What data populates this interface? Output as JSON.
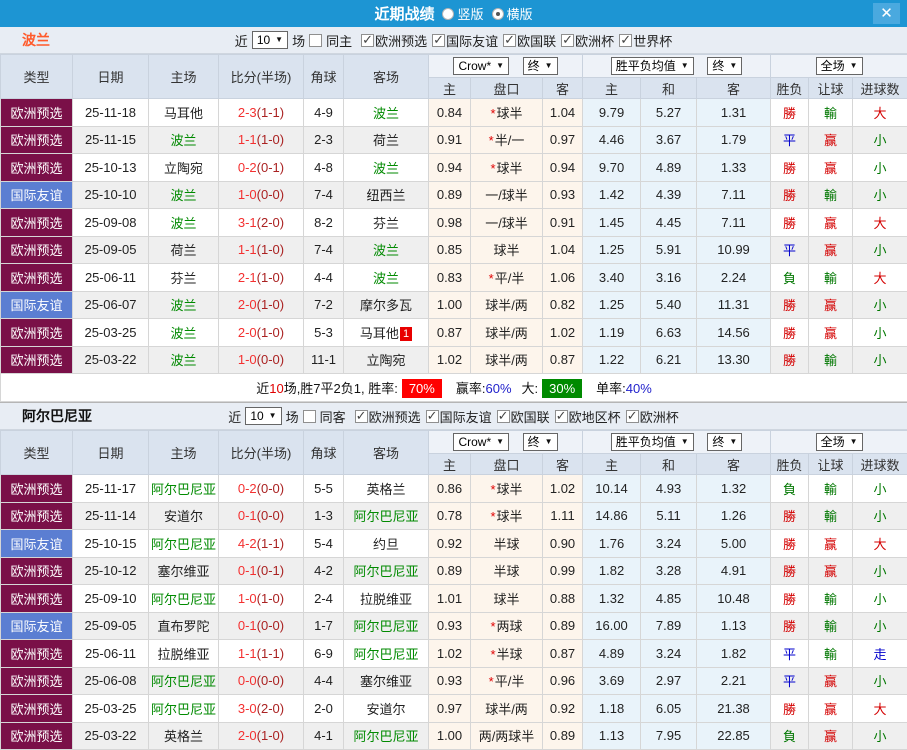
{
  "titlebar": {
    "title": "近期战绩",
    "radios": [
      {
        "label": "竖版",
        "checked": false
      },
      {
        "label": "横版",
        "checked": true
      }
    ],
    "close_icon": "✕"
  },
  "labels": {
    "near": "近",
    "games": "场"
  },
  "controls": {
    "count": "10",
    "odds_source": "Crow*",
    "final": "终",
    "avg": "胜平负均值",
    "fullmatch": "全场"
  },
  "columns": {
    "type": "类型",
    "date": "日期",
    "home": "主场",
    "score": "比分(半场)",
    "corner": "角球",
    "away": "客场",
    "o_home": "主",
    "o_hcp": "盘口",
    "o_away": "客",
    "a_home": "主",
    "a_draw": "和",
    "a_away": "客",
    "r_wdl": "胜负",
    "r_let": "让球",
    "r_goals": "进球数"
  },
  "sections": [
    {
      "team": "波兰",
      "filter": {
        "count": "10",
        "same": {
          "label": "同主",
          "checked": false
        },
        "leagues": [
          {
            "label": "欧洲预选",
            "checked": true
          },
          {
            "label": "国际友谊",
            "checked": true
          },
          {
            "label": "欧国联",
            "checked": true
          },
          {
            "label": "欧洲杯",
            "checked": true
          },
          {
            "label": "世界杯",
            "checked": true
          }
        ]
      },
      "rows": [
        {
          "type": "欧洲预选",
          "friendly": false,
          "date": "25-11-18",
          "home": "马耳他",
          "home_hl": false,
          "score": "2-3",
          "half": "(1-1)",
          "corner": "4-9",
          "away": "波兰",
          "away_hl": true,
          "away_badge": "",
          "odds": [
            "0.84",
            "*球半",
            "1.04"
          ],
          "avg": [
            "9.79",
            "5.27",
            "1.31"
          ],
          "res": [
            "勝",
            "輸",
            "大"
          ]
        },
        {
          "type": "欧洲预选",
          "friendly": false,
          "date": "25-11-15",
          "home": "波兰",
          "home_hl": true,
          "score": "1-1",
          "half": "(1-0)",
          "corner": "2-3",
          "away": "荷兰",
          "away_hl": false,
          "away_badge": "",
          "odds": [
            "0.91",
            "*半/一",
            "0.97"
          ],
          "avg": [
            "4.46",
            "3.67",
            "1.79"
          ],
          "res": [
            "平",
            "赢",
            "小"
          ]
        },
        {
          "type": "欧洲预选",
          "friendly": false,
          "date": "25-10-13",
          "home": "立陶宛",
          "home_hl": false,
          "score": "0-2",
          "half": "(0-1)",
          "corner": "4-8",
          "away": "波兰",
          "away_hl": true,
          "away_badge": "",
          "odds": [
            "0.94",
            "*球半",
            "0.94"
          ],
          "avg": [
            "9.70",
            "4.89",
            "1.33"
          ],
          "res": [
            "勝",
            "赢",
            "小"
          ]
        },
        {
          "type": "国际友谊",
          "friendly": true,
          "date": "25-10-10",
          "home": "波兰",
          "home_hl": true,
          "score": "1-0",
          "half": "(0-0)",
          "corner": "7-4",
          "away": "纽西兰",
          "away_hl": false,
          "away_badge": "",
          "odds": [
            "0.89",
            "一/球半",
            "0.93"
          ],
          "avg": [
            "1.42",
            "4.39",
            "7.11"
          ],
          "res": [
            "勝",
            "輸",
            "小"
          ]
        },
        {
          "type": "欧洲预选",
          "friendly": false,
          "date": "25-09-08",
          "home": "波兰",
          "home_hl": true,
          "score": "3-1",
          "half": "(2-0)",
          "corner": "8-2",
          "away": "芬兰",
          "away_hl": false,
          "away_badge": "",
          "odds": [
            "0.98",
            "一/球半",
            "0.91"
          ],
          "avg": [
            "1.45",
            "4.45",
            "7.11"
          ],
          "res": [
            "勝",
            "赢",
            "大"
          ]
        },
        {
          "type": "欧洲预选",
          "friendly": false,
          "date": "25-09-05",
          "home": "荷兰",
          "home_hl": false,
          "score": "1-1",
          "half": "(1-0)",
          "corner": "7-4",
          "away": "波兰",
          "away_hl": true,
          "away_badge": "",
          "odds": [
            "0.85",
            "球半",
            "1.04"
          ],
          "avg": [
            "1.25",
            "5.91",
            "10.99"
          ],
          "res": [
            "平",
            "赢",
            "小"
          ]
        },
        {
          "type": "欧洲预选",
          "friendly": false,
          "date": "25-06-11",
          "home": "芬兰",
          "home_hl": false,
          "score": "2-1",
          "half": "(1-0)",
          "corner": "4-4",
          "away": "波兰",
          "away_hl": true,
          "away_badge": "",
          "odds": [
            "0.83",
            "*平/半",
            "1.06"
          ],
          "avg": [
            "3.40",
            "3.16",
            "2.24"
          ],
          "res": [
            "負",
            "輸",
            "大"
          ]
        },
        {
          "type": "国际友谊",
          "friendly": true,
          "date": "25-06-07",
          "home": "波兰",
          "home_hl": true,
          "score": "2-0",
          "half": "(1-0)",
          "corner": "7-2",
          "away": "摩尔多瓦",
          "away_hl": false,
          "away_badge": "",
          "odds": [
            "1.00",
            "球半/两",
            "0.82"
          ],
          "avg": [
            "1.25",
            "5.40",
            "11.31"
          ],
          "res": [
            "勝",
            "赢",
            "小"
          ]
        },
        {
          "type": "欧洲预选",
          "friendly": false,
          "date": "25-03-25",
          "home": "波兰",
          "home_hl": true,
          "score": "2-0",
          "half": "(1-0)",
          "corner": "5-3",
          "away": "马耳他",
          "away_hl": false,
          "away_badge": "1",
          "odds": [
            "0.87",
            "球半/两",
            "1.02"
          ],
          "avg": [
            "1.19",
            "6.63",
            "14.56"
          ],
          "res": [
            "勝",
            "赢",
            "小"
          ]
        },
        {
          "type": "欧洲预选",
          "friendly": false,
          "date": "25-03-22",
          "home": "波兰",
          "home_hl": true,
          "score": "1-0",
          "half": "(0-0)",
          "corner": "11-1",
          "away": "立陶宛",
          "away_hl": false,
          "away_badge": "",
          "odds": [
            "1.02",
            "球半/两",
            "0.87"
          ],
          "avg": [
            "1.22",
            "6.21",
            "13.30"
          ],
          "res": [
            "勝",
            "輸",
            "小"
          ]
        }
      ],
      "summary": {
        "near_label": "近",
        "near_count": "10",
        "record": "场,胜7平2负1, 胜率:",
        "win_badge": "70%",
        "profit_label": "赢率:",
        "profit_rate": "60%",
        "big_label": "大:",
        "big_badge": "30%",
        "single_label": "单率:",
        "single_rate": "40%"
      }
    },
    {
      "team": "阿尔巴尼亚",
      "filter": {
        "count": "10",
        "same": {
          "label": "同客",
          "checked": false
        },
        "leagues": [
          {
            "label": "欧洲预选",
            "checked": true
          },
          {
            "label": "国际友谊",
            "checked": true
          },
          {
            "label": "欧国联",
            "checked": true
          },
          {
            "label": "欧地区杯",
            "checked": true
          },
          {
            "label": "欧洲杯",
            "checked": true
          }
        ]
      },
      "rows": [
        {
          "type": "欧洲预选",
          "friendly": false,
          "date": "25-11-17",
          "home": "阿尔巴尼亚",
          "home_hl": true,
          "score": "0-2",
          "half": "(0-0)",
          "corner": "5-5",
          "away": "英格兰",
          "away_hl": false,
          "away_badge": "",
          "odds": [
            "0.86",
            "*球半",
            "1.02"
          ],
          "avg": [
            "10.14",
            "4.93",
            "1.32"
          ],
          "res": [
            "負",
            "輸",
            "小"
          ]
        },
        {
          "type": "欧洲预选",
          "friendly": false,
          "date": "25-11-14",
          "home": "安道尔",
          "home_hl": false,
          "score": "0-1",
          "half": "(0-0)",
          "corner": "1-3",
          "away": "阿尔巴尼亚",
          "away_hl": true,
          "away_badge": "",
          "odds": [
            "0.78",
            "*球半",
            "1.11"
          ],
          "avg": [
            "14.86",
            "5.11",
            "1.26"
          ],
          "res": [
            "勝",
            "輸",
            "小"
          ]
        },
        {
          "type": "国际友谊",
          "friendly": true,
          "date": "25-10-15",
          "home": "阿尔巴尼亚",
          "home_hl": true,
          "score": "4-2",
          "half": "(1-1)",
          "corner": "5-4",
          "away": "约旦",
          "away_hl": false,
          "away_badge": "",
          "odds": [
            "0.92",
            "半球",
            "0.90"
          ],
          "avg": [
            "1.76",
            "3.24",
            "5.00"
          ],
          "res": [
            "勝",
            "赢",
            "大"
          ]
        },
        {
          "type": "欧洲预选",
          "friendly": false,
          "date": "25-10-12",
          "home": "塞尔维亚",
          "home_hl": false,
          "score": "0-1",
          "half": "(0-1)",
          "corner": "4-2",
          "away": "阿尔巴尼亚",
          "away_hl": true,
          "away_badge": "",
          "odds": [
            "0.89",
            "半球",
            "0.99"
          ],
          "avg": [
            "1.82",
            "3.28",
            "4.91"
          ],
          "res": [
            "勝",
            "赢",
            "小"
          ]
        },
        {
          "type": "欧洲预选",
          "friendly": false,
          "date": "25-09-10",
          "home": "阿尔巴尼亚",
          "home_hl": true,
          "score": "1-0",
          "half": "(1-0)",
          "corner": "2-4",
          "away": "拉脱维亚",
          "away_hl": false,
          "away_badge": "",
          "odds": [
            "1.01",
            "球半",
            "0.88"
          ],
          "avg": [
            "1.32",
            "4.85",
            "10.48"
          ],
          "res": [
            "勝",
            "輸",
            "小"
          ]
        },
        {
          "type": "国际友谊",
          "friendly": true,
          "date": "25-09-05",
          "home": "直布罗陀",
          "home_hl": false,
          "score": "0-1",
          "half": "(0-0)",
          "corner": "1-7",
          "away": "阿尔巴尼亚",
          "away_hl": true,
          "away_badge": "",
          "odds": [
            "0.93",
            "*两球",
            "0.89"
          ],
          "avg": [
            "16.00",
            "7.89",
            "1.13"
          ],
          "res": [
            "勝",
            "輸",
            "小"
          ]
        },
        {
          "type": "欧洲预选",
          "friendly": false,
          "date": "25-06-11",
          "home": "拉脱维亚",
          "home_hl": false,
          "score": "1-1",
          "half": "(1-1)",
          "corner": "6-9",
          "away": "阿尔巴尼亚",
          "away_hl": true,
          "away_badge": "",
          "odds": [
            "1.02",
            "*半球",
            "0.87"
          ],
          "avg": [
            "4.89",
            "3.24",
            "1.82"
          ],
          "res": [
            "平",
            "輸",
            "走"
          ]
        },
        {
          "type": "欧洲预选",
          "friendly": false,
          "date": "25-06-08",
          "home": "阿尔巴尼亚",
          "home_hl": true,
          "score": "0-0",
          "half": "(0-0)",
          "corner": "4-4",
          "away": "塞尔维亚",
          "away_hl": false,
          "away_badge": "",
          "odds": [
            "0.93",
            "*平/半",
            "0.96"
          ],
          "avg": [
            "3.69",
            "2.97",
            "2.21"
          ],
          "res": [
            "平",
            "赢",
            "小"
          ]
        },
        {
          "type": "欧洲预选",
          "friendly": false,
          "date": "25-03-25",
          "home": "阿尔巴尼亚",
          "home_hl": true,
          "score": "3-0",
          "half": "(2-0)",
          "corner": "2-0",
          "away": "安道尔",
          "away_hl": false,
          "away_badge": "",
          "odds": [
            "0.97",
            "球半/两",
            "0.92"
          ],
          "avg": [
            "1.18",
            "6.05",
            "21.38"
          ],
          "res": [
            "勝",
            "赢",
            "大"
          ]
        },
        {
          "type": "欧洲预选",
          "friendly": false,
          "date": "25-03-22",
          "home": "英格兰",
          "home_hl": false,
          "score": "2-0",
          "half": "(1-0)",
          "corner": "4-1",
          "away": "阿尔巴尼亚",
          "away_hl": true,
          "away_badge": "",
          "odds": [
            "1.00",
            "两/两球半",
            "0.89"
          ],
          "avg": [
            "1.13",
            "7.95",
            "22.85"
          ],
          "res": [
            "負",
            "赢",
            "小"
          ]
        }
      ],
      "summary": null
    }
  ]
}
